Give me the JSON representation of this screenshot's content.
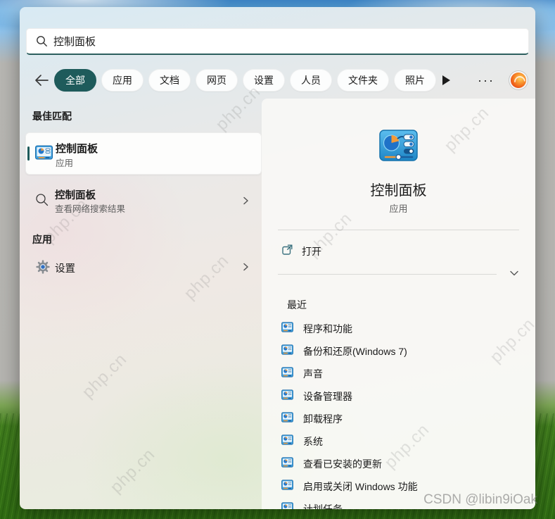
{
  "accent": {
    "teal": "#1e5b5b",
    "underline": "#2c5f5e"
  },
  "search": {
    "value": "控制面板"
  },
  "tabs": {
    "items": [
      {
        "label": "全部",
        "selected": true
      },
      {
        "label": "应用",
        "selected": false
      },
      {
        "label": "文档",
        "selected": false
      },
      {
        "label": "网页",
        "selected": false
      },
      {
        "label": "设置",
        "selected": false
      },
      {
        "label": "人员",
        "selected": false
      },
      {
        "label": "文件夹",
        "selected": false
      },
      {
        "label": "照片",
        "selected": false
      }
    ],
    "more_glyph": "···"
  },
  "left": {
    "best_match_header": "最佳匹配",
    "best_match": {
      "title": "控制面板",
      "subtitle": "应用"
    },
    "web_search_item": {
      "title": "控制面板",
      "subtitle": "查看网络搜索结果"
    },
    "apps_header": "应用",
    "settings_item": {
      "label": "设置"
    }
  },
  "detail": {
    "title": "控制面板",
    "subtitle": "应用",
    "open_label": "打开",
    "recent_header": "最近",
    "recent_items": [
      "程序和功能",
      "备份和还原(Windows 7)",
      "声音",
      "设备管理器",
      "卸载程序",
      "系统",
      "查看已安装的更新",
      "启用或关闭 Windows 功能",
      "计划任务"
    ]
  },
  "watermarks": {
    "php": "php.cn",
    "csdn": "CSDN @libin9iOak"
  }
}
